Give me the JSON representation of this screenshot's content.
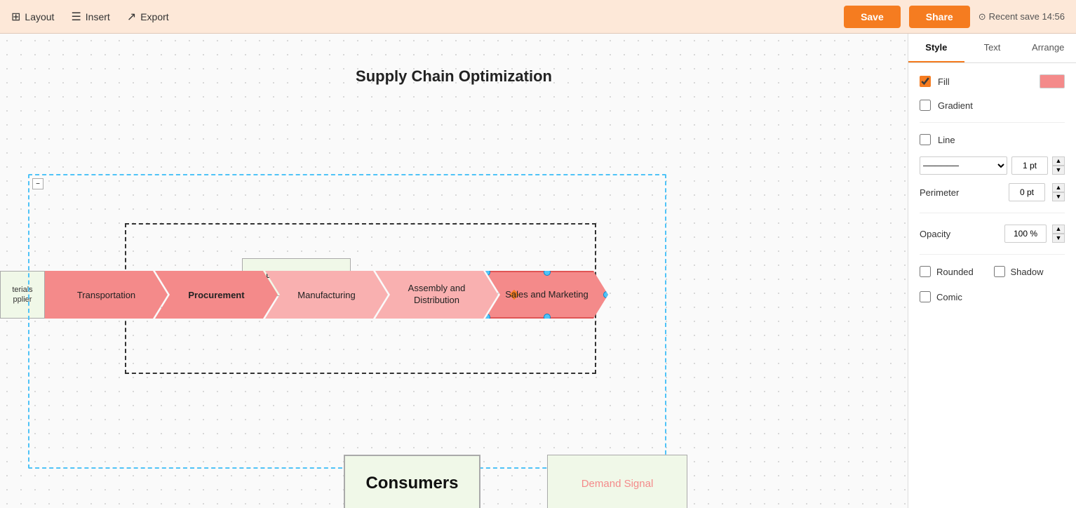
{
  "toolbar": {
    "layout_label": "Layout",
    "insert_label": "Insert",
    "export_label": "Export",
    "save_label": "Save",
    "share_label": "Share",
    "recent_save": "Recent save 14:56"
  },
  "diagram": {
    "title": "Supply Chain Optimization",
    "chevrons": [
      {
        "id": "transportation",
        "label": "Transportation",
        "color": "#f48a8a"
      },
      {
        "id": "procurement",
        "label": "Procurement",
        "color": "#f48a8a",
        "bold": true
      },
      {
        "id": "manufacturing",
        "label": "Manufacturing",
        "color": "#f9b0b0"
      },
      {
        "id": "assembly",
        "label": "Assembly and Distribution",
        "color": "#f9b0b0"
      },
      {
        "id": "sales",
        "label": "Sales and Marketing",
        "color": "#f48a8a",
        "selected": true
      }
    ],
    "labels": {
      "product_flow": "Product Flow",
      "consumers": "Consumers",
      "demand_signal": "Demand Signal",
      "materials": "terials\nplier"
    }
  },
  "right_panel": {
    "tabs": [
      "Style",
      "Text",
      "Arrange"
    ],
    "active_tab": "Style",
    "fill_label": "Fill",
    "fill_checked": true,
    "fill_color": "#f48a8a",
    "gradient_label": "Gradient",
    "gradient_checked": false,
    "line_label": "Line",
    "line_checked": false,
    "line_pt": "1 pt",
    "perimeter_label": "Perimeter",
    "perimeter_pt": "0 pt",
    "opacity_label": "Opacity",
    "opacity_value": "100 %",
    "rounded_label": "Rounded",
    "rounded_checked": false,
    "shadow_label": "Shadow",
    "shadow_checked": false,
    "comic_label": "Comic",
    "comic_checked": false
  }
}
